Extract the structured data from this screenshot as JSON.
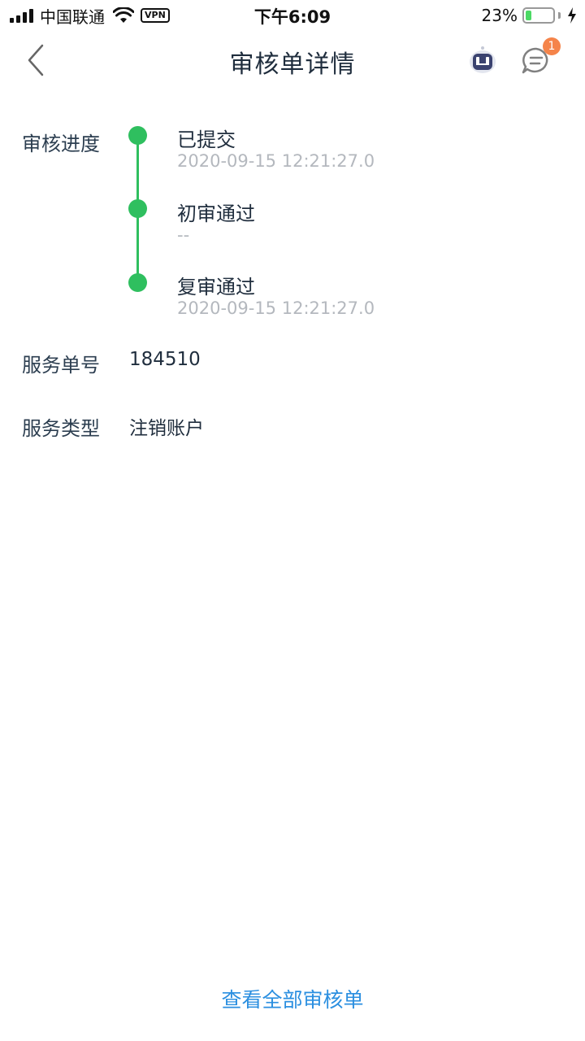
{
  "status_bar": {
    "carrier": "中国联通",
    "vpn": "VPN",
    "time": "下午6:09",
    "battery_percent": "23%",
    "battery_level": 0.23,
    "battery_color": "#4cd964"
  },
  "nav": {
    "title": "审核单详情",
    "back_icon": "chevron-left-icon",
    "robot_icon": "robot-assistant-icon",
    "message_icon": "chat-bubble-icon",
    "message_badge": "1",
    "badge_color": "#f5844a"
  },
  "review": {
    "label": "审核进度",
    "accent_color": "#2fbf5f",
    "steps": [
      {
        "title": "已提交",
        "time": "2020-09-15 12:21:27.0"
      },
      {
        "title": "初审通过",
        "time": "--"
      },
      {
        "title": "复审通过",
        "time": "2020-09-15 12:21:27.0"
      }
    ]
  },
  "details": {
    "service_no_label": "服务单号",
    "service_no_value": "184510",
    "service_type_label": "服务类型",
    "service_type_value": "注销账户"
  },
  "footer": {
    "link_label": "查看全部审核单",
    "link_color": "#2b8fe0"
  }
}
